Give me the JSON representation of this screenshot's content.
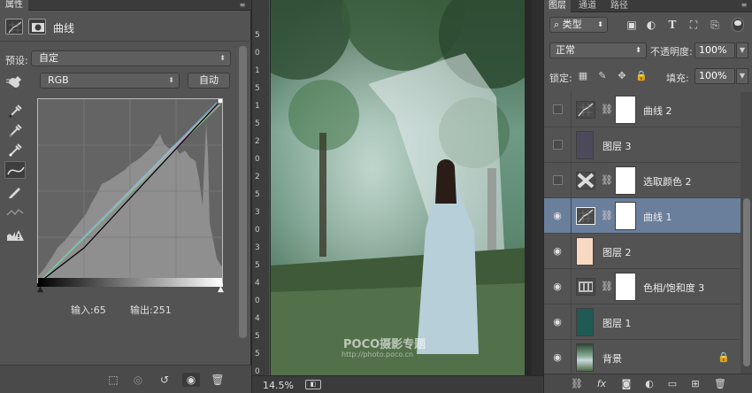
{
  "properties_panel": {
    "tab_label": "属性",
    "title": "曲线",
    "preset_label": "预设:",
    "preset_value": "自定",
    "channel_value": "RGB",
    "auto_button": "自动",
    "input_text": "输入:65",
    "output_text": "输出:251",
    "curve_point": {
      "input": 65,
      "output": 251
    }
  },
  "canvas": {
    "zoom": "14.5%",
    "ruler_numbers": [
      "5",
      "0",
      "1",
      "5",
      "1",
      "5",
      "2",
      "0",
      "2",
      "5",
      "3",
      "0",
      "3",
      "5",
      "4",
      "0",
      "4",
      "5",
      "5",
      "0"
    ],
    "watermark": "POCO摄影专题",
    "watermark_url": "http://photo.poco.cn"
  },
  "layers_panel": {
    "tabs": [
      "图层",
      "通道",
      "路径"
    ],
    "filter_value": "类型",
    "blend_mode": "正常",
    "opacity_label": "不透明度:",
    "opacity_value": "100%",
    "lock_label": "锁定:",
    "fill_label": "填充:",
    "fill_value": "100%",
    "layers": [
      {
        "name": "曲线 2",
        "type": "adjustment",
        "adj_icon": "curves-icon",
        "visible": false,
        "selected": false
      },
      {
        "name": "图层 3",
        "type": "fill",
        "color": "#4c4a5a",
        "visible": false,
        "selected": false
      },
      {
        "name": "选取颜色 2",
        "type": "adjustment",
        "adj_icon": "selective-color-icon",
        "visible": false,
        "selected": false
      },
      {
        "name": "曲线 1",
        "type": "adjustment",
        "adj_icon": "curves-icon",
        "visible": true,
        "selected": true
      },
      {
        "name": "图层 2",
        "type": "fill",
        "color": "#f8d9c2",
        "visible": true,
        "selected": false
      },
      {
        "name": "色相/饱和度 3",
        "type": "adjustment",
        "adj_icon": "hue-saturation-icon",
        "visible": true,
        "selected": false
      },
      {
        "name": "图层 1",
        "type": "fill",
        "color": "#1f5a54",
        "visible": true,
        "selected": false
      },
      {
        "name": "背景",
        "type": "image",
        "visible": true,
        "selected": false,
        "locked": true
      }
    ]
  },
  "colors": {
    "panel": "#535353",
    "selection": "#6a7f9c",
    "dark": "#282828"
  }
}
